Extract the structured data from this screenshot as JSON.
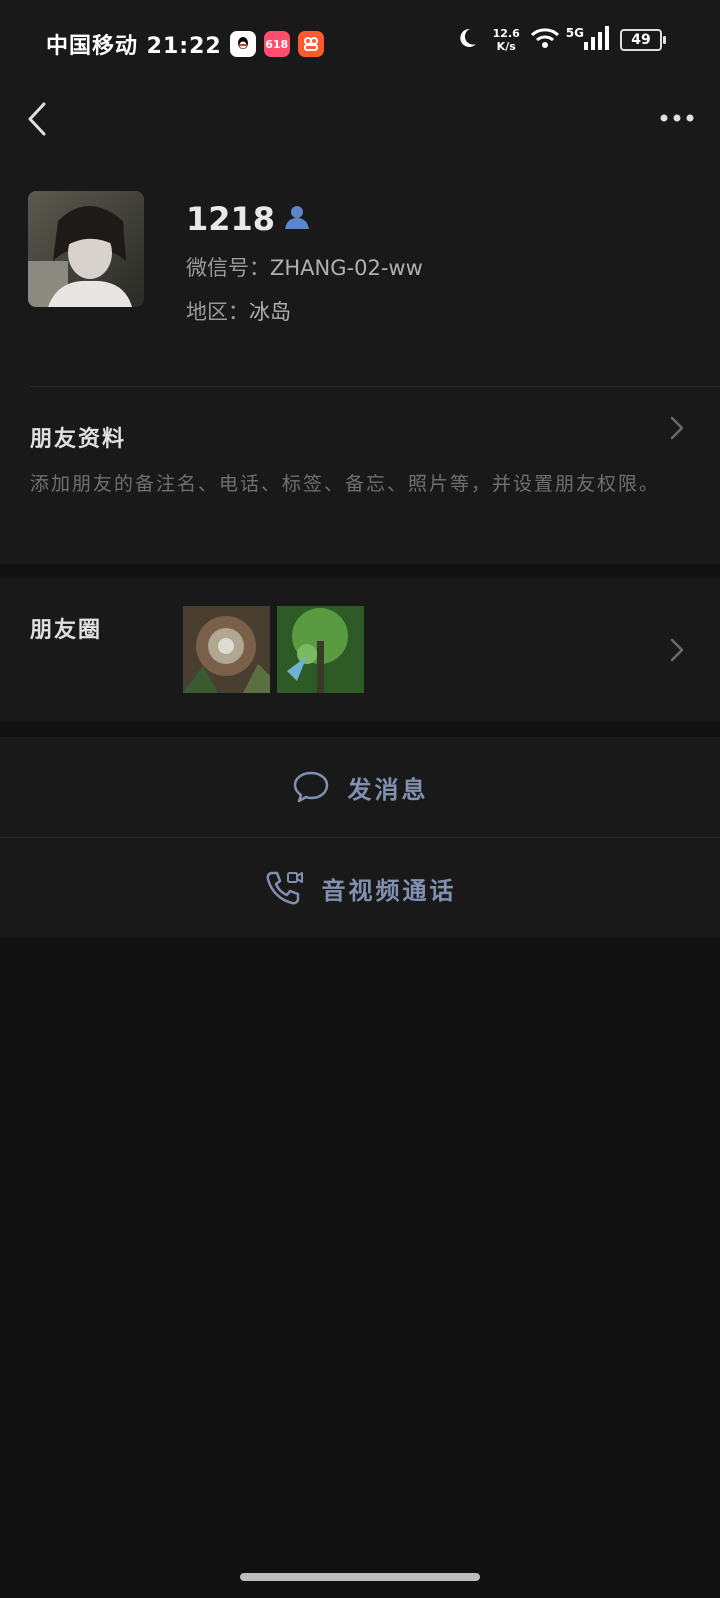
{
  "status_bar": {
    "carrier_time": "中国移动 21:22",
    "app_icons": [
      "qq-icon",
      "618-app-icon",
      "red-app-icon"
    ],
    "app_618_label": "618",
    "net_speed_value": "12.6",
    "net_speed_unit": "K/s",
    "network": "5G",
    "battery": "49"
  },
  "profile": {
    "nickname": "1218",
    "wechat_id_label": "微信号：",
    "wechat_id": "ZHANG-02-ww",
    "region_label": "地区：",
    "region": "冰岛"
  },
  "friend_info": {
    "title": "朋友资料",
    "description": "添加朋友的备注名、电话、标签、备忘、照片等，并设置朋友权限。"
  },
  "moments": {
    "title": "朋友圈"
  },
  "actions": {
    "message": "发消息",
    "call": "音视频通话"
  },
  "colors": {
    "background": "#111111",
    "panel": "#191919",
    "link": "#8190b0",
    "verified_icon": "#5b86c9"
  }
}
